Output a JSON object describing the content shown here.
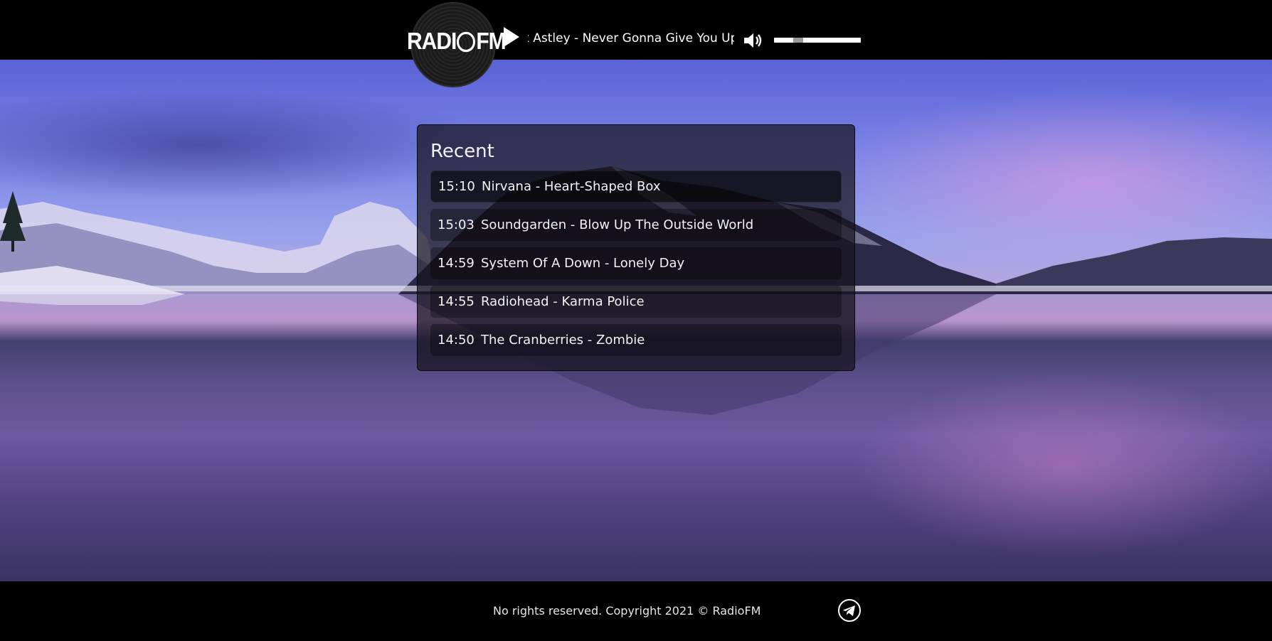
{
  "header": {
    "logo_text_left": "RADI",
    "logo_text_right": "FM",
    "now_playing": "k Astley - Never Gonna Give You Up",
    "volume_level": 0.25
  },
  "recent": {
    "title": "Recent",
    "tracks": [
      {
        "time": "15:10",
        "title": "Nirvana - Heart-Shaped Box"
      },
      {
        "time": "15:03",
        "title": "Soundgarden - Blow Up The Outside World"
      },
      {
        "time": "14:59",
        "title": "System Of A Down - Lonely Day"
      },
      {
        "time": "14:55",
        "title": "Radiohead - Karma Police"
      },
      {
        "time": "14:50",
        "title": "The Cranberries - Zombie"
      }
    ]
  },
  "footer": {
    "copyright": "No rights reserved. Copyright 2021 © RadioFM"
  },
  "icons": {
    "play": "play-icon",
    "volume": "volume-icon",
    "telegram": "telegram-icon",
    "logo": "vinyl-record-logo"
  },
  "colors": {
    "bar_background": "#000000",
    "panel_background": "#16141e",
    "text": "#ffffff"
  }
}
